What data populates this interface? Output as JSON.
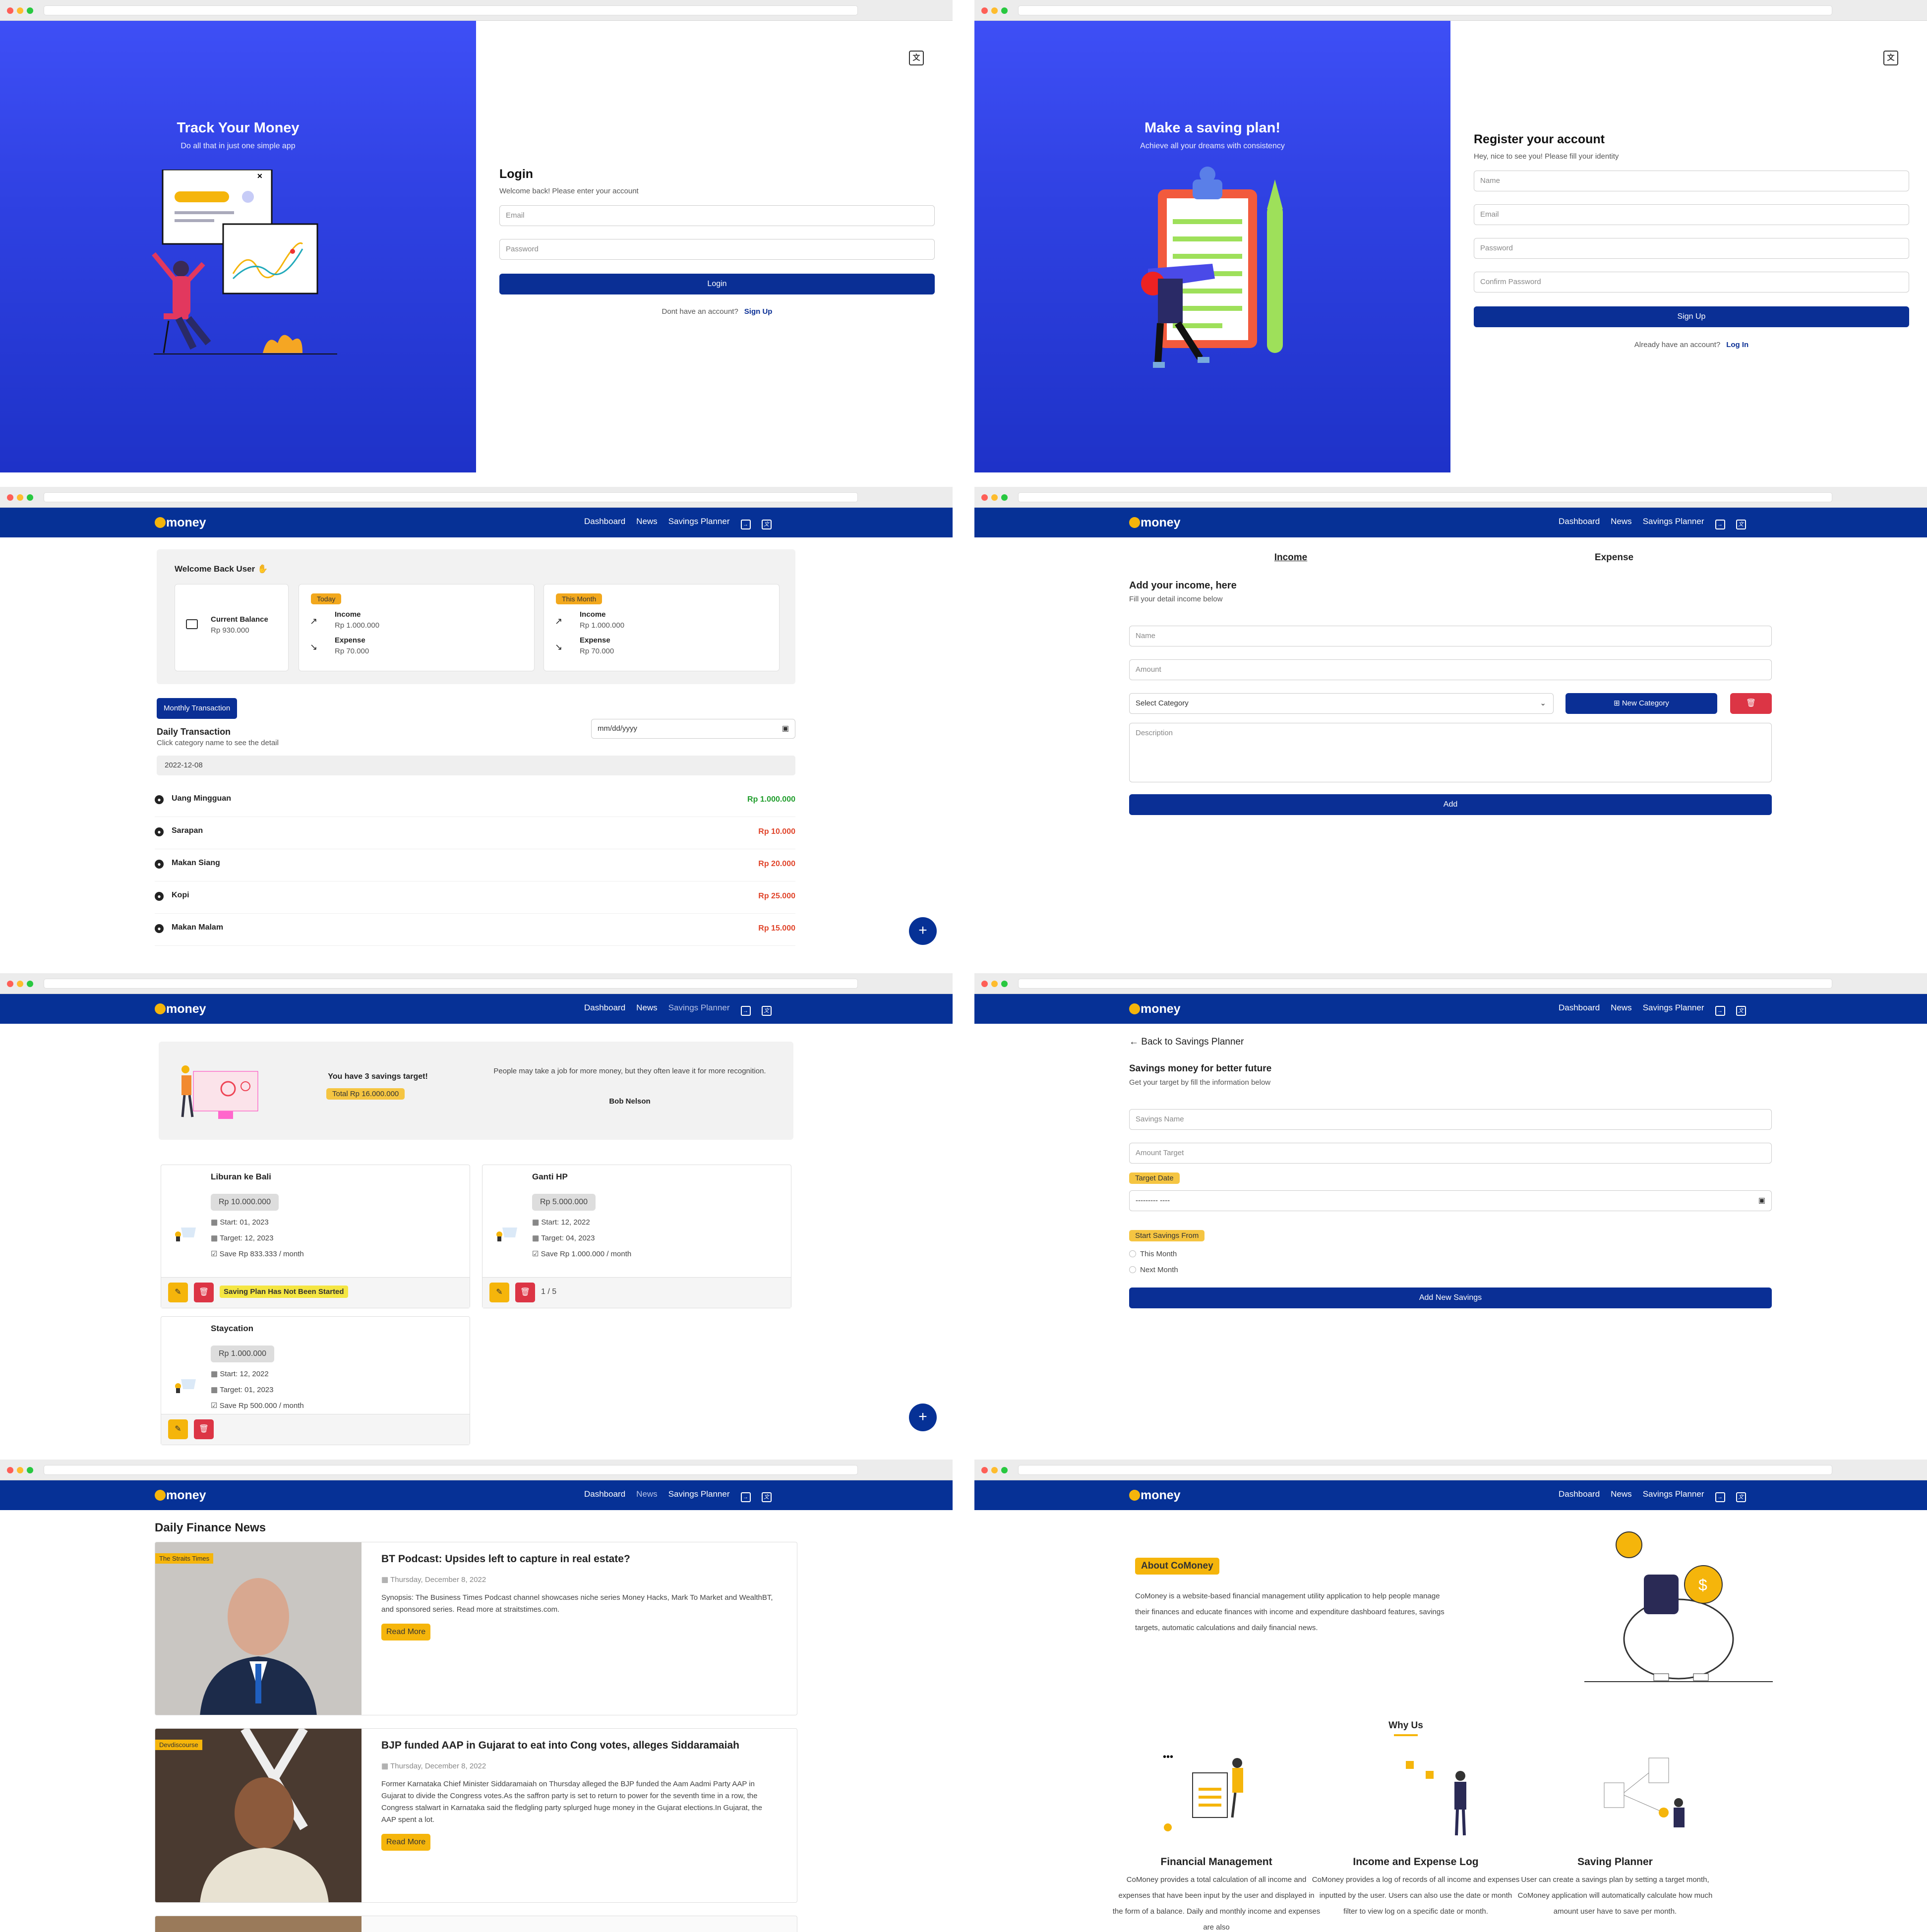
{
  "login": {
    "hero_title": "Track Your Money",
    "hero_subtitle": "Do all that in just one simple app",
    "form_title": "Login",
    "form_subtitle": "Welcome back! Please enter your account",
    "email_placeholder": "Email",
    "password_placeholder": "Password",
    "submit_label": "Login",
    "alt_text": "Dont have an account?",
    "alt_link": "Sign Up"
  },
  "register": {
    "hero_title": "Make a saving plan!",
    "hero_subtitle": "Achieve all your dreams with consistency",
    "form_title": "Register your account",
    "form_subtitle": "Hey, nice to see you! Please fill your identity",
    "name_placeholder": "Name",
    "email_placeholder": "Email",
    "password_placeholder": "Password",
    "confirm_placeholder": "Confirm Password",
    "submit_label": "Sign Up",
    "alt_text": "Already have an account?",
    "alt_link": "Log In"
  },
  "nav": {
    "logo_text": "money",
    "links": [
      "Dashboard",
      "News",
      "Savings Planner"
    ]
  },
  "dashboard": {
    "welcome": "Welcome Back User",
    "current_balance_label": "Current Balance",
    "current_balance_value": "Rp 930.000",
    "today_badge": "Today",
    "month_badge": "This Month",
    "income_label": "Income",
    "expense_label": "Expense",
    "today_income": "Rp 1.000.000",
    "today_expense": "Rp 70.000",
    "month_income": "Rp 1.000.000",
    "month_expense": "Rp 70.000",
    "monthly_button": "Monthly Transaction",
    "daily_title": "Daily Transaction",
    "daily_subtitle": "Click category name to see the detail",
    "date_placeholder": "mm/dd/yyyy",
    "date_header": "2022-12-08",
    "transactions": [
      {
        "name": "Uang Mingguan",
        "amount": "Rp 1.000.000",
        "color": "#1f9d2b"
      },
      {
        "name": "Sarapan",
        "amount": "Rp 10.000",
        "color": "#e0442a"
      },
      {
        "name": "Makan Siang",
        "amount": "Rp 20.000",
        "color": "#e0442a"
      },
      {
        "name": "Kopi",
        "amount": "Rp 25.000",
        "color": "#e0442a"
      },
      {
        "name": "Makan Malam",
        "amount": "Rp 15.000",
        "color": "#e0442a"
      }
    ],
    "fab": "+"
  },
  "income_form": {
    "tab_income": "Income",
    "tab_expense": "Expense",
    "title": "Add your income, here",
    "subtitle": "Fill your detail income below",
    "name_placeholder": "Name",
    "amount_placeholder": "Amount",
    "category_select": "Select Category",
    "new_category": "New Category",
    "description_placeholder": "Description",
    "submit_label": "Add"
  },
  "planner": {
    "target_text": "You have 3 savings target!",
    "total_badge": "Total Rp 16.000.000",
    "quote": "People may take a job for more money, but they often leave it for more recognition.",
    "quote_author": "Bob Nelson",
    "cards": [
      {
        "name": "Liburan ke Bali",
        "amount": "Rp 10.000.000",
        "start": "Start: 01, 2023",
        "target": "Target: 12, 2023",
        "save": "Save Rp 833.333 / month",
        "status": "Saving Plan Has Not Been Started"
      },
      {
        "name": "Ganti HP",
        "amount": "Rp 5.000.000",
        "start": "Start: 12, 2022",
        "target": "Target: 04, 2023",
        "save": "Save Rp 1.000.000 / month",
        "status": "1 / 5"
      },
      {
        "name": "Staycation",
        "amount": "Rp 1.000.000",
        "start": "Start: 12, 2022",
        "target": "Target: 01, 2023",
        "save": "Save Rp 500.000 / month",
        "status": ""
      }
    ],
    "fab": "+"
  },
  "add_savings": {
    "back": "Back to Savings Planner",
    "title": "Savings money for better future",
    "subtitle": "Get your target by fill the information below",
    "name_placeholder": "Savings Name",
    "amount_placeholder": "Amount Target",
    "target_date_label": "Target Date",
    "date_value": "--------- ----",
    "start_label": "Start Savings From",
    "option_this": "This Month",
    "option_next": "Next Month",
    "submit_label": "Add New Savings"
  },
  "news": {
    "title": "Daily Finance News",
    "articles": [
      {
        "source": "The Straits Times",
        "headline": "BT Podcast: Upsides left to capture in real estate?",
        "date": "Thursday, December 8, 2022",
        "summary": "Synopsis: The Business Times Podcast channel showcases niche series Money Hacks, Mark To Market and WealthBT, and sponsored series. Read more at straitstimes.com.",
        "button": "Read More"
      },
      {
        "source": "Devdiscourse",
        "headline": "BJP funded AAP in Gujarat to eat into Cong votes, alleges Siddaramaiah",
        "date": "Thursday, December 8, 2022",
        "summary": "Former Karnataka Chief Minister Siddaramaiah on Thursday alleged the BJP funded the Aam Aadmi Party AAP in Gujarat to divide the Congress votes.As the saffron party is set to return to power for the seventh time in a row, the Congress stalwart in Karnataka said the fledgling party splurged huge money in the Gujarat elections.In Gujarat, the AAP spent a lot.",
        "button": "Read More"
      }
    ]
  },
  "about": {
    "badge": "About CoMoney",
    "description": "CoMoney is a website-based financial management utility application to help people manage their finances and educate finances with income and expenditure dashboard features, savings targets, automatic calculations and daily financial news.",
    "why_title": "Why Us",
    "features": [
      {
        "title": "Financial Management",
        "text": "CoMoney provides a total calculation of all income and expenses that have been input by the user and displayed in the form of a balance. Daily and monthly income and expenses are also"
      },
      {
        "title": "Income and Expense Log",
        "text": "CoMoney provides a log of records of all income and expenses inputted by the user. Users can also use the date or month filter to view log on a specific date or month."
      },
      {
        "title": "Saving Planner",
        "text": "User can create a savings plan by setting a target month, CoMoney application will automatically calculate how much amount user have to save per month."
      }
    ]
  },
  "colors": {
    "primary": "#063196",
    "accent": "#f5b50b",
    "hero": "#3446ea",
    "danger": "#dc3545"
  }
}
